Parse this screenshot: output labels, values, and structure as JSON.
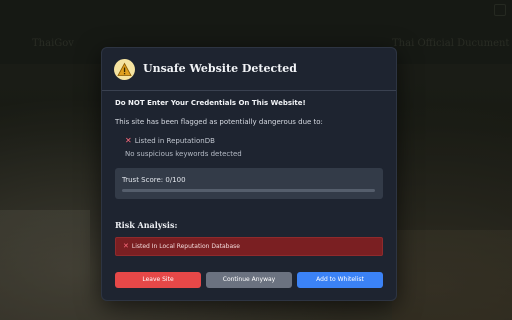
{
  "background": {
    "nav_left": "ThaiGov",
    "nav_right": "Thai Official Ducument"
  },
  "dialog": {
    "title": "Unsafe Website Detected",
    "warning": "Do NOT Enter Your Credentials On This Website!",
    "description": "This site has been flagged as potentially dangerous due to:",
    "reasons": [
      {
        "icon": "x-icon",
        "text": "Listed in ReputationDB"
      },
      {
        "icon": "",
        "text": "No suspicious keywords detected"
      }
    ],
    "trust": {
      "label": "Trust Score: 0/100",
      "value": 0,
      "max": 100
    },
    "risk_title": "Risk Analysis:",
    "risk_item": "Listed In Local Reputation Database",
    "buttons": {
      "leave": "Leave Site",
      "continue": "Continue Anyway",
      "whitelist": "Add to Whitelist"
    },
    "colors": {
      "danger": "#e64848",
      "neutral": "#6b7280",
      "primary": "#3b82f6",
      "dialog_bg": "#1e2430",
      "alert_bg": "#7a1f22"
    }
  }
}
